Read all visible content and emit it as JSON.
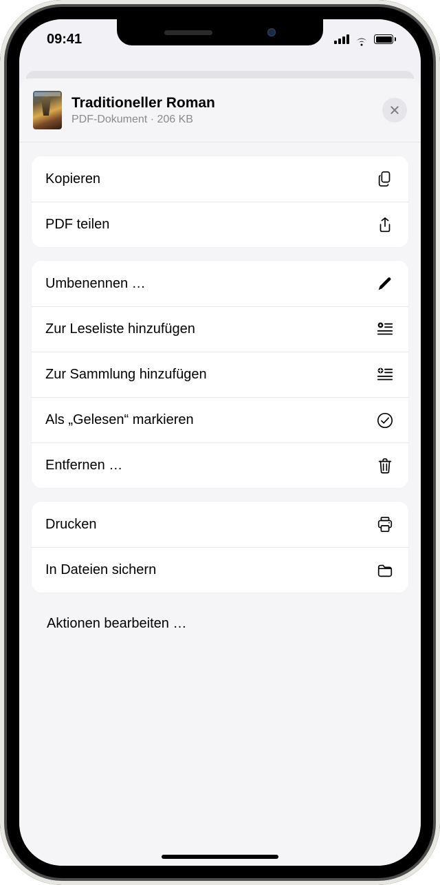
{
  "status": {
    "time": "09:41"
  },
  "header": {
    "title": "Traditioneller Roman",
    "subtitle": "PDF-Dokument · 206 KB"
  },
  "groups": [
    {
      "rows": [
        {
          "label": "Kopieren",
          "icon": "copy"
        },
        {
          "label": "PDF teilen",
          "icon": "share"
        }
      ]
    },
    {
      "rows": [
        {
          "label": "Umbenennen …",
          "icon": "pencil"
        },
        {
          "label": "Zur Leseliste hinzufügen",
          "icon": "star-list"
        },
        {
          "label": "Zur Sammlung hinzufügen",
          "icon": "plus-list"
        },
        {
          "label": "Als „Gelesen“ markieren",
          "icon": "checkmark"
        },
        {
          "label": "Entfernen …",
          "icon": "trash"
        }
      ]
    },
    {
      "rows": [
        {
          "label": "Drucken",
          "icon": "printer"
        },
        {
          "label": "In Dateien sichern",
          "icon": "folder"
        }
      ]
    }
  ],
  "edit_actions_label": "Aktionen bearbeiten …"
}
